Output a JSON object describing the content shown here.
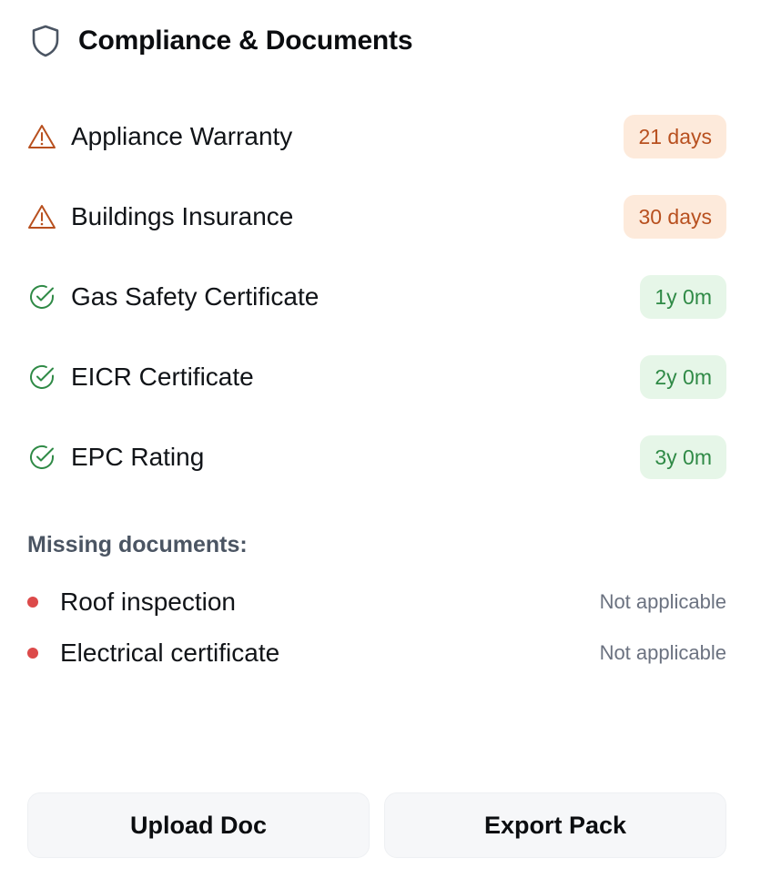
{
  "header": {
    "title": "Compliance & Documents",
    "icon": "shield-icon"
  },
  "items": [
    {
      "label": "Appliance Warranty",
      "status_text": "21 days",
      "status": "warning",
      "icon": "warning-triangle-icon"
    },
    {
      "label": "Buildings Insurance",
      "status_text": "30 days",
      "status": "warning",
      "icon": "warning-triangle-icon"
    },
    {
      "label": "Gas Safety Certificate",
      "status_text": "1y 0m",
      "status": "ok",
      "icon": "check-circle-icon"
    },
    {
      "label": "EICR Certificate",
      "status_text": "2y 0m",
      "status": "ok",
      "icon": "check-circle-icon"
    },
    {
      "label": "EPC Rating",
      "status_text": "3y 0m",
      "status": "ok",
      "icon": "check-circle-icon"
    }
  ],
  "missing": {
    "title": "Missing documents:",
    "rows": [
      {
        "label": "Roof inspection",
        "status_text": "Not applicable"
      },
      {
        "label": "Electrical certificate",
        "status_text": "Not applicable"
      }
    ]
  },
  "actions": {
    "upload_label": "Upload Doc",
    "export_label": "Export Pack"
  },
  "colors": {
    "warning_text": "#b8501f",
    "warning_bg": "#fdeadb",
    "ok_text": "#2f8a46",
    "ok_bg": "#e6f6e8",
    "missing_dot": "#dc4a4a"
  }
}
